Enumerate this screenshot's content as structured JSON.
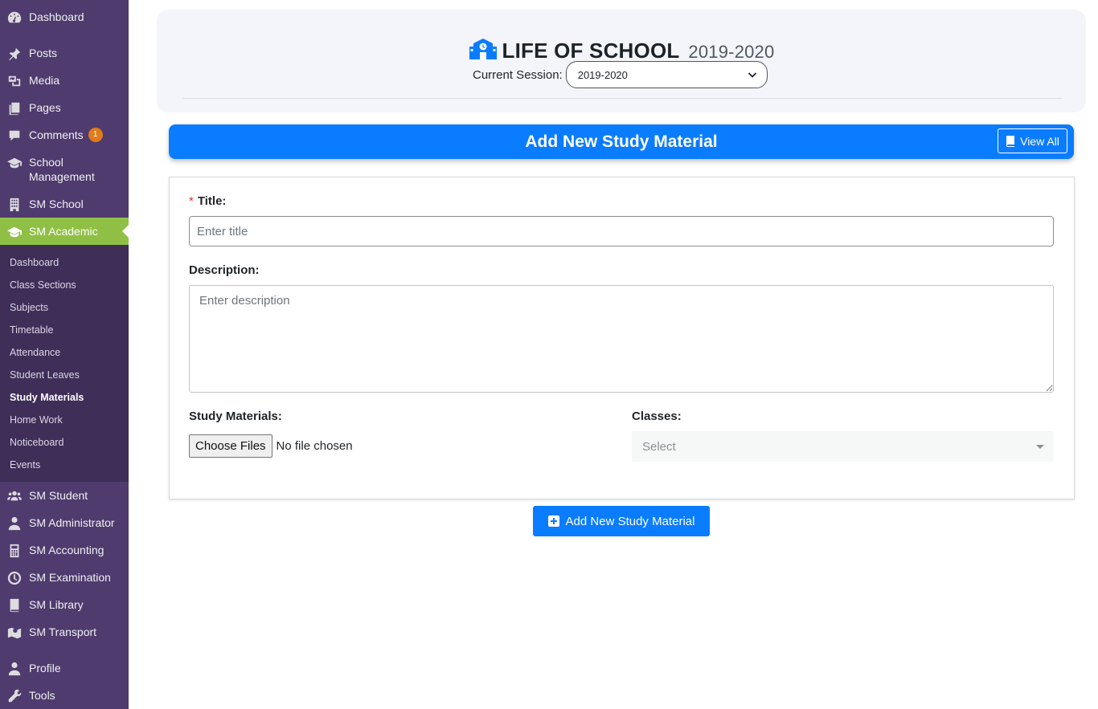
{
  "sidebar": {
    "items": [
      {
        "label": "Dashboard",
        "icon": "dashboard-icon"
      },
      {
        "label": "Posts",
        "icon": "pin-icon"
      },
      {
        "label": "Media",
        "icon": "media-icon"
      },
      {
        "label": "Pages",
        "icon": "pages-icon"
      },
      {
        "label": "Comments",
        "icon": "comment-icon",
        "badge": "1"
      },
      {
        "label": "School Management",
        "icon": "graduation-cap-icon"
      },
      {
        "label": "SM School",
        "icon": "building-icon"
      },
      {
        "label": "SM Academic",
        "icon": "graduation-cap-icon",
        "active": true
      },
      {
        "label": "SM Student",
        "icon": "users-icon"
      },
      {
        "label": "SM Administrator",
        "icon": "user-tie-icon"
      },
      {
        "label": "SM Accounting",
        "icon": "calculator-icon"
      },
      {
        "label": "SM Examination",
        "icon": "clock-icon"
      },
      {
        "label": "SM Library",
        "icon": "book-icon"
      },
      {
        "label": "SM Transport",
        "icon": "map-icon"
      },
      {
        "label": "Profile",
        "icon": "user-icon"
      },
      {
        "label": "Tools",
        "icon": "wrench-icon"
      }
    ],
    "submenu": [
      {
        "label": "Dashboard"
      },
      {
        "label": "Class Sections"
      },
      {
        "label": "Subjects"
      },
      {
        "label": "Timetable"
      },
      {
        "label": "Attendance"
      },
      {
        "label": "Student Leaves"
      },
      {
        "label": "Study Materials",
        "current": true
      },
      {
        "label": "Home Work"
      },
      {
        "label": "Noticeboard"
      },
      {
        "label": "Events"
      }
    ]
  },
  "header": {
    "school_name": "LIFE OF SCHOOL",
    "year": "2019-2020",
    "session_label": "Current Session:",
    "session_value": "2019-2020"
  },
  "banner": {
    "title": "Add New Study Material",
    "view_all_label": "View All"
  },
  "form": {
    "title_required_mark": "*",
    "title_label": "Title:",
    "title_placeholder": "Enter title",
    "description_label": "Description:",
    "description_placeholder": "Enter description",
    "study_materials_label": "Study Materials:",
    "file_button_label": "Choose Files",
    "file_status": "No file chosen",
    "classes_label": "Classes:",
    "classes_placeholder": "Select",
    "submit_label": "Add New Study Material"
  },
  "colors": {
    "sidebar_bg": "#4f3b6e",
    "submenu_bg": "#3e2e58",
    "active_bg": "#8fc045",
    "accent": "#0a7cff",
    "badge": "#e07b1b"
  }
}
